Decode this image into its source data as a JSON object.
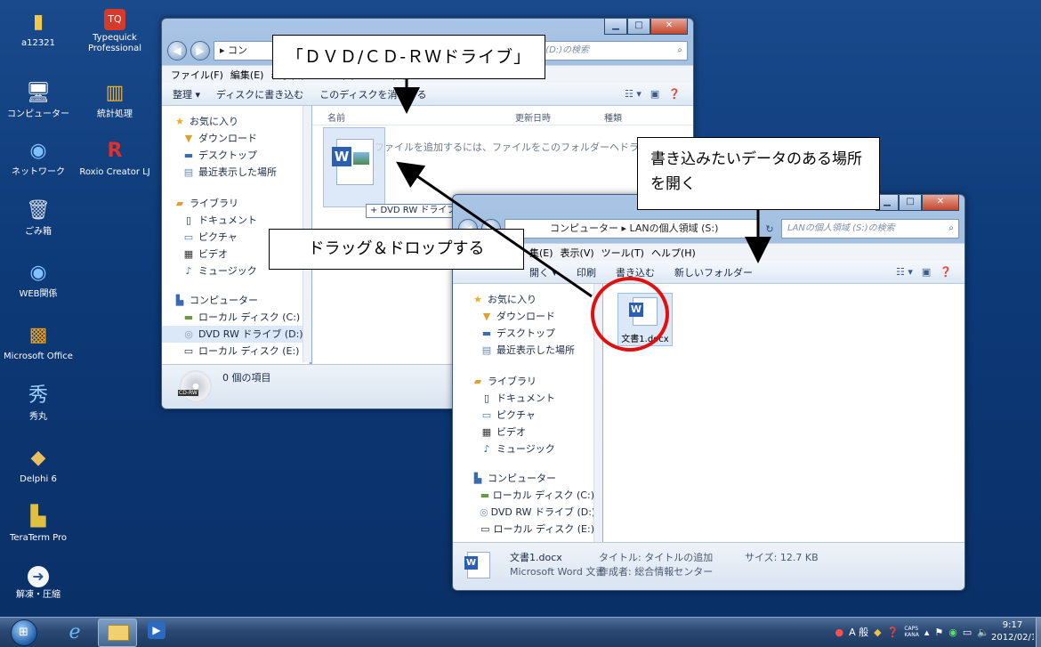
{
  "desktop": {
    "icons": [
      {
        "label": "a12321",
        "icon": "user-folder-icon"
      },
      {
        "label": "Typequick Professional",
        "icon": "typequick-icon"
      },
      {
        "label": "コンピューター",
        "icon": "computer-icon"
      },
      {
        "label": "統計処理",
        "icon": "stats-icon"
      },
      {
        "label": "ネットワーク",
        "icon": "network-icon"
      },
      {
        "label": "Roxio Creator LJ",
        "icon": "roxio-icon"
      },
      {
        "label": "ごみ箱",
        "icon": "recycle-bin-icon"
      },
      {
        "label": "WEB関係",
        "icon": "web-icon"
      },
      {
        "label": "Microsoft Office",
        "icon": "office-icon"
      },
      {
        "label": "秀丸",
        "icon": "hidemaru-icon"
      },
      {
        "label": "Delphi 6",
        "icon": "delphi-icon"
      },
      {
        "label": "TeraTerm Pro",
        "icon": "teraterm-icon"
      },
      {
        "label": "解凍・圧縮",
        "icon": "archive-icon"
      }
    ]
  },
  "window_dvd": {
    "address": "コン",
    "search_placeholder": "ライブ (D:)の検索",
    "menu": [
      "ファイル(F)",
      "編集(E)",
      "表示(V)",
      "ツール(T)",
      "ヘルプ(H)"
    ],
    "toolbar": [
      "整理 ▾",
      "ディスクに書き込む",
      "このディスクを消去する"
    ],
    "nav": {
      "favorites": "お気に入り",
      "fav_items": [
        "ダウンロード",
        "デスクトップ",
        "最近表示した場所"
      ],
      "libraries": "ライブラリ",
      "lib_items": [
        "ドキュメント",
        "ピクチャ",
        "ビデオ",
        "ミュージック"
      ],
      "computer": "コンピューター",
      "comp_items": [
        "ローカル ディスク (C:)",
        "DVD RW ドライブ (D:)",
        "ローカル ディスク (E:)"
      ]
    },
    "columns": [
      "名前",
      "更新日時",
      "種類"
    ],
    "empty_hint": "ファイルを追加するには、ファイルをこのフォルダーへドラッグしてく",
    "drag_tooltip": "+ DVD RW ドライブ (D:) へコピー",
    "status": "0 個の項目",
    "status_icon": "CD-RW"
  },
  "window_lan": {
    "address": "コンピューター ▸ LANの個人領域 (S:)",
    "search_placeholder": "LANの個人領域 (S:)の検索",
    "menu": [
      "集(E)",
      "表示(V)",
      "ツール(T)",
      "ヘルプ(H)"
    ],
    "toolbar": [
      "開く ▾",
      "印刷",
      "書き込む",
      "新しいフォルダー"
    ],
    "nav": {
      "favorites": "お気に入り",
      "fav_items": [
        "ダウンロード",
        "デスクトップ",
        "最近表示した場所"
      ],
      "libraries": "ライブラリ",
      "lib_items": [
        "ドキュメント",
        "ピクチャ",
        "ビデオ",
        "ミュージック"
      ],
      "computer": "コンピューター",
      "comp_items": [
        "ローカル ディスク (C:)",
        "DVD RW ドライブ (D:)",
        "ローカル ディスク (E:)"
      ]
    },
    "file": {
      "name": "文書1.docx"
    },
    "details": {
      "name": "文書1.docx",
      "type": "Microsoft Word 文書",
      "title": "タイトル: タイトルの追加",
      "author": "作成者: 総合情報センター",
      "size": "サイズ: 12.7 KB"
    }
  },
  "callouts": {
    "dvd_drive": "「ＤＶＤ/ＣＤ-ＲＷドライブ」",
    "drag_drop": "ドラッグ＆ドロップする",
    "open_location": "書き込みたいデータのある場所を開く"
  },
  "taskbar": {
    "tray_text": "A 般",
    "time": "9:17",
    "date": "2012/02/10",
    "caps": "CAPS",
    "kana": "KANA"
  },
  "colors": {
    "highlight_circle": "#e01010",
    "desktop": "#0d3a78"
  }
}
